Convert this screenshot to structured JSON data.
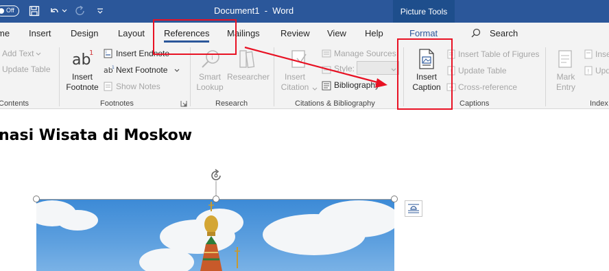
{
  "titlebar": {
    "autosave_label": "Off",
    "document_title": "Document1  -  Word",
    "context_tab": "Picture Tools"
  },
  "tabs": [
    {
      "label": "me"
    },
    {
      "label": "Insert"
    },
    {
      "label": "Design"
    },
    {
      "label": "Layout"
    },
    {
      "label": "References"
    },
    {
      "label": "Mailings"
    },
    {
      "label": "Review"
    },
    {
      "label": "View"
    },
    {
      "label": "Help"
    },
    {
      "label": "Format"
    }
  ],
  "search": {
    "label": "Search"
  },
  "ribbon": {
    "contents_group": {
      "add_text": "Add Text",
      "update_table": "Update Table",
      "label": "Contents"
    },
    "footnotes_group": {
      "insert_footnote": [
        "Insert",
        "Footnote"
      ],
      "insert_endnote": "Insert Endnote",
      "next_footnote": "Next Footnote",
      "show_notes": "Show Notes",
      "label": "Footnotes"
    },
    "research_group": {
      "smart_lookup": [
        "Smart",
        "Lookup"
      ],
      "researcher": "Researcher",
      "label": "Research"
    },
    "citations_group": {
      "insert_citation": [
        "Insert",
        "Citation"
      ],
      "manage_sources": "Manage Sources",
      "style": "Style:",
      "bibliography": "Bibliography",
      "label": "Citations & Bibliography"
    },
    "captions_group": {
      "insert_caption": [
        "Insert",
        "Caption"
      ],
      "insert_table_of_figures": "Insert Table of Figures",
      "update_table": "Update Table",
      "cross_reference": "Cross-reference",
      "label": "Captions"
    },
    "index_group": {
      "mark_entry": [
        "Mark",
        "Entry"
      ],
      "insert": "Inse",
      "update": "Upd",
      "label": "Index"
    }
  },
  "document": {
    "heading": "nasi Wisata di Moskow"
  },
  "colors": {
    "word_blue": "#2b579a",
    "annotation_red": "#e81123"
  }
}
